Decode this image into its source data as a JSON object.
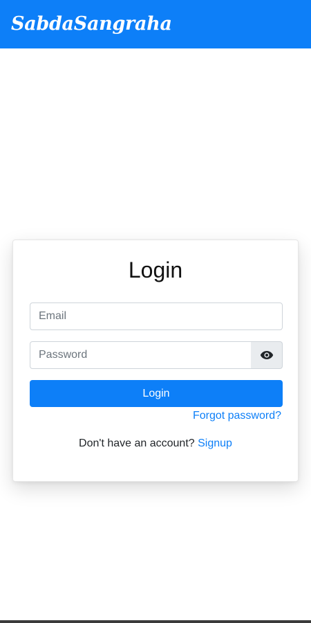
{
  "app": {
    "brand": "SabdaSangraha"
  },
  "login": {
    "title": "Login",
    "email_placeholder": "Email",
    "password_placeholder": "Password",
    "submit_label": "Login",
    "forgot_label": "Forgot password?",
    "no_account_text": "Don't have an account?",
    "signup_label": "Signup"
  },
  "icons": {
    "toggle_password": "eye-icon"
  },
  "colors": {
    "primary": "#0d7ff8",
    "input_addon_bg": "#e9ecef"
  }
}
